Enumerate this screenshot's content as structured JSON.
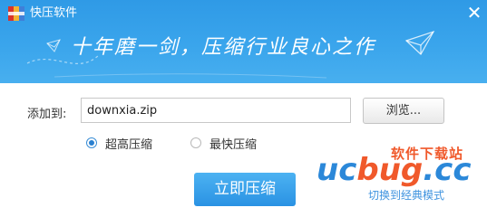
{
  "window": {
    "title": "快压软件",
    "slogan": "十年磨一剑，压缩行业良心之作",
    "close_glyph": "✕"
  },
  "form": {
    "dest_label": "添加到:",
    "path_value": "downxia.zip",
    "browse_label": "浏览...",
    "options": [
      {
        "label": "超高压缩",
        "selected": true
      },
      {
        "label": "最快压缩",
        "selected": false
      }
    ],
    "start_label": "立即压缩"
  },
  "watermark": {
    "top": "软件下载站",
    "logo_a": "uc",
    "logo_b": "bug",
    "logo_c": ".cc",
    "sub": "切换到经典模式"
  },
  "colors": {
    "header": "#3aa5ec",
    "accent": "#2a92e3",
    "watermark_orange": "#f0592b",
    "watermark_blue": "#2b88d9"
  },
  "icons": {
    "app": "app-icon",
    "close": "close-icon",
    "paper-plane": "paper-plane-icon"
  }
}
